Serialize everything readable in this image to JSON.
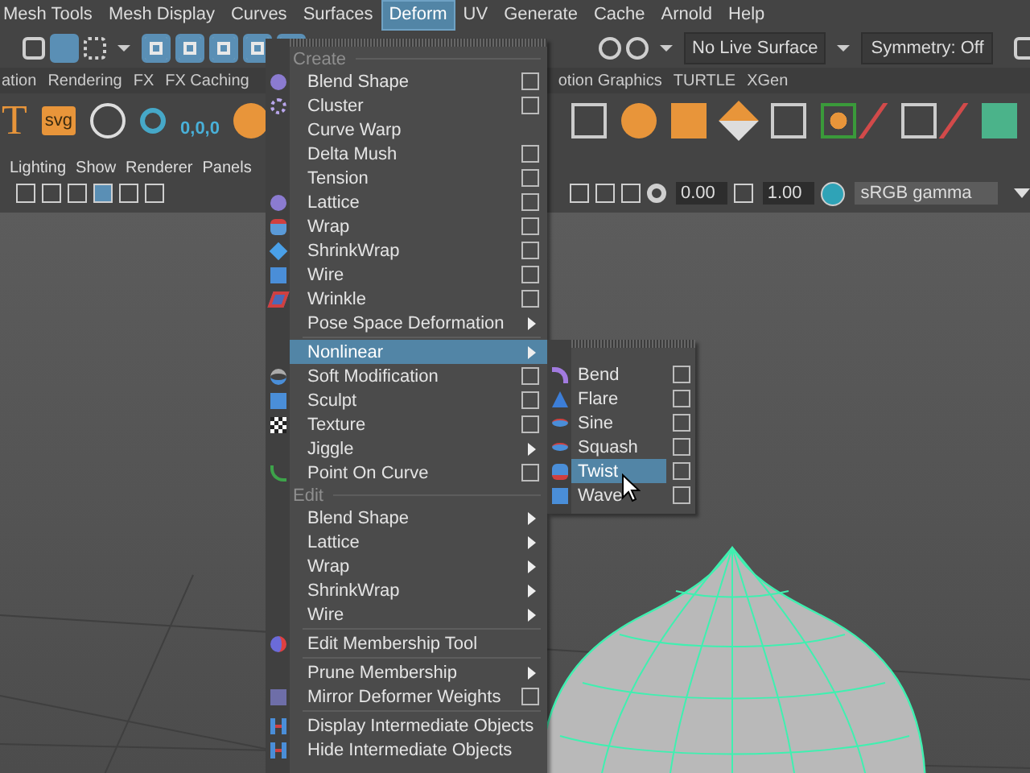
{
  "menu_bar": [
    {
      "label": "Mesh Tools",
      "selected": false
    },
    {
      "label": "Mesh Display",
      "selected": false
    },
    {
      "label": "Curves",
      "selected": false
    },
    {
      "label": "Surfaces",
      "selected": false
    },
    {
      "label": "Deform",
      "selected": true
    },
    {
      "label": "UV",
      "selected": false
    },
    {
      "label": "Generate",
      "selected": false
    },
    {
      "label": "Cache",
      "selected": false
    },
    {
      "label": "Arnold",
      "selected": false
    },
    {
      "label": "Help",
      "selected": false
    }
  ],
  "status_line": {
    "live_surface": "No Live Surface",
    "symmetry": "Symmetry: Off"
  },
  "shelf_tabs": [
    "ation",
    "Rendering",
    "FX",
    "FX Caching",
    "otion Graphics",
    "TURTLE",
    "XGen"
  ],
  "shelf": {
    "text_tool": "T",
    "svg_tool": "svg",
    "reset_label": "0,0,0"
  },
  "panel_menu": [
    "Lighting",
    "Show",
    "Renderer",
    "Panels"
  ],
  "panel_toolbar": {
    "exposure": "0.00",
    "gamma": "1.00",
    "color_space": "sRGB gamma"
  },
  "deform_menu": {
    "items": [
      {
        "kind": "header",
        "label": "Create"
      },
      {
        "kind": "option",
        "label": "Blend Shape",
        "selected": false
      },
      {
        "kind": "option",
        "label": "Cluster",
        "selected": false
      },
      {
        "kind": "plain",
        "label": "Curve Warp",
        "selected": false
      },
      {
        "kind": "option",
        "label": "Delta Mush",
        "selected": false
      },
      {
        "kind": "option",
        "label": "Tension",
        "selected": false
      },
      {
        "kind": "option",
        "label": "Lattice",
        "selected": false
      },
      {
        "kind": "option",
        "label": "Wrap",
        "selected": false
      },
      {
        "kind": "option",
        "label": "ShrinkWrap",
        "selected": false
      },
      {
        "kind": "option",
        "label": "Wire",
        "selected": false
      },
      {
        "kind": "option",
        "label": "Wrinkle",
        "selected": false
      },
      {
        "kind": "submenu",
        "label": "Pose Space Deformation",
        "selected": false
      },
      {
        "kind": "separator"
      },
      {
        "kind": "submenu",
        "label": "Nonlinear",
        "selected": true
      },
      {
        "kind": "option",
        "label": "Soft Modification",
        "selected": false
      },
      {
        "kind": "option",
        "label": "Sculpt",
        "selected": false
      },
      {
        "kind": "option",
        "label": "Texture",
        "selected": false
      },
      {
        "kind": "submenu",
        "label": "Jiggle",
        "selected": false
      },
      {
        "kind": "option",
        "label": "Point On Curve",
        "selected": false
      },
      {
        "kind": "header",
        "label": "Edit"
      },
      {
        "kind": "submenu",
        "label": "Blend Shape",
        "selected": false
      },
      {
        "kind": "submenu",
        "label": "Lattice",
        "selected": false
      },
      {
        "kind": "submenu",
        "label": "Wrap",
        "selected": false
      },
      {
        "kind": "submenu",
        "label": "ShrinkWrap",
        "selected": false
      },
      {
        "kind": "submenu",
        "label": "Wire",
        "selected": false
      },
      {
        "kind": "separator"
      },
      {
        "kind": "plain",
        "label": "Edit Membership Tool",
        "selected": false
      },
      {
        "kind": "separator"
      },
      {
        "kind": "submenu",
        "label": "Prune Membership",
        "selected": false
      },
      {
        "kind": "option",
        "label": "Mirror Deformer Weights",
        "selected": false
      },
      {
        "kind": "separator"
      },
      {
        "kind": "plain",
        "label": "Display Intermediate Objects",
        "selected": false
      },
      {
        "kind": "plain",
        "label": "Hide Intermediate Objects",
        "selected": false
      }
    ]
  },
  "nonlinear_submenu": {
    "items": [
      {
        "kind": "option",
        "label": "Bend",
        "selected": false
      },
      {
        "kind": "option",
        "label": "Flare",
        "selected": false
      },
      {
        "kind": "option",
        "label": "Sine",
        "selected": false
      },
      {
        "kind": "option",
        "label": "Squash",
        "selected": false
      },
      {
        "kind": "option",
        "label": "Twist",
        "selected": true
      },
      {
        "kind": "option",
        "label": "Wave",
        "selected": false
      }
    ]
  }
}
